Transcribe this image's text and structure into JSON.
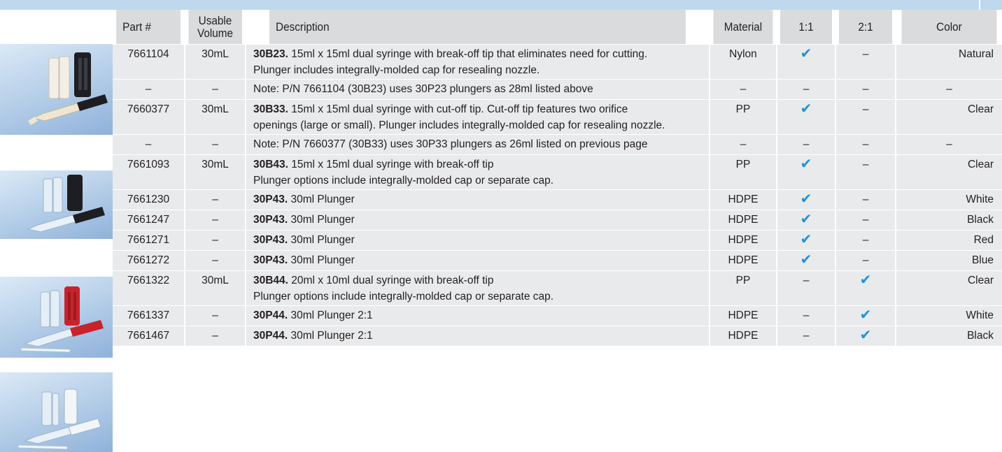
{
  "table": {
    "headers": {
      "part": "Part #",
      "volume_line1": "Usable",
      "volume_line2": "Volume",
      "description": "Description",
      "material": "Material",
      "ratio_11": "1:1",
      "ratio_21": "2:1",
      "color": "Color"
    },
    "rows": [
      {
        "part": "7661104",
        "volume": "30mL",
        "code": "30B23.",
        "desc": "15ml x 15ml dual syringe with break-off tip that eliminates need for cutting.",
        "desc2": "Plunger includes integrally-molded cap for resealing nozzle.",
        "material": "Nylon",
        "r11": "✔",
        "r21": "–",
        "color": "Natural"
      },
      {
        "part": "–",
        "volume": "–",
        "code": "",
        "desc": "Note: P/N 7661104 (30B23) uses 30P23 plungers as 28ml listed above",
        "desc2": "",
        "material": "–",
        "r11": "–",
        "r21": "–",
        "color": "–"
      },
      {
        "part": "7660377",
        "volume": "30mL",
        "code": "30B33.",
        "desc": "15ml x 15ml dual syringe with cut-off tip. Cut-off tip features two orifice",
        "desc2": "openings (large or small). Plunger includes integrally-molded cap for resealing nozzle.",
        "material": "PP",
        "r11": "✔",
        "r21": "–",
        "color": "Clear"
      },
      {
        "part": "–",
        "volume": "–",
        "code": "",
        "desc": "Note: P/N 7660377 (30B33) uses 30P33 plungers as 26ml listed on previous page",
        "desc2": "",
        "material": "–",
        "r11": "–",
        "r21": "–",
        "color": "–"
      },
      {
        "part": "7661093",
        "volume": "30mL",
        "code": "30B43.",
        "desc": "15ml x 15ml dual syringe with break-off tip",
        "desc2": "Plunger options include integrally-molded cap or separate cap.",
        "material": "PP",
        "r11": "✔",
        "r21": "–",
        "color": "Clear"
      },
      {
        "part": "7661230",
        "volume": "–",
        "code": "30P43.",
        "desc": "30ml Plunger",
        "desc2": "",
        "material": "HDPE",
        "r11": "✔",
        "r21": "–",
        "color": "White"
      },
      {
        "part": "7661247",
        "volume": "–",
        "code": "30P43.",
        "desc": "30ml Plunger",
        "desc2": "",
        "material": "HDPE",
        "r11": "✔",
        "r21": "–",
        "color": "Black"
      },
      {
        "part": "7661271",
        "volume": "–",
        "code": "30P43.",
        "desc": "30ml Plunger",
        "desc2": "",
        "material": "HDPE",
        "r11": "✔",
        "r21": "–",
        "color": "Red"
      },
      {
        "part": "7661272",
        "volume": "–",
        "code": "30P43.",
        "desc": "30ml Plunger",
        "desc2": "",
        "material": "HDPE",
        "r11": "✔",
        "r21": "–",
        "color": "Blue"
      },
      {
        "part": "7661322",
        "volume": "30mL",
        "code": "30B44.",
        "desc": "20ml x 10ml dual syringe with break-off tip",
        "desc2": "Plunger options include integrally-molded cap or separate cap.",
        "material": "PP",
        "r11": "–",
        "r21": "✔",
        "color": "Clear"
      },
      {
        "part": "7661337",
        "volume": "–",
        "code": "30P44.",
        "desc": "30ml Plunger 2:1",
        "desc2": "",
        "material": "HDPE",
        "r11": "–",
        "r21": "✔",
        "color": "White"
      },
      {
        "part": "7661467",
        "volume": "–",
        "code": "30P44.",
        "desc": "30ml Plunger 2:1",
        "desc2": "",
        "material": "HDPE",
        "r11": "–",
        "r21": "✔",
        "color": "Black"
      }
    ]
  },
  "colors": {
    "header_bg": "#d9dbdd",
    "row_bg": "#e9eaeb",
    "top_bar": "#bfd8ee",
    "check": "#1f93d8"
  }
}
